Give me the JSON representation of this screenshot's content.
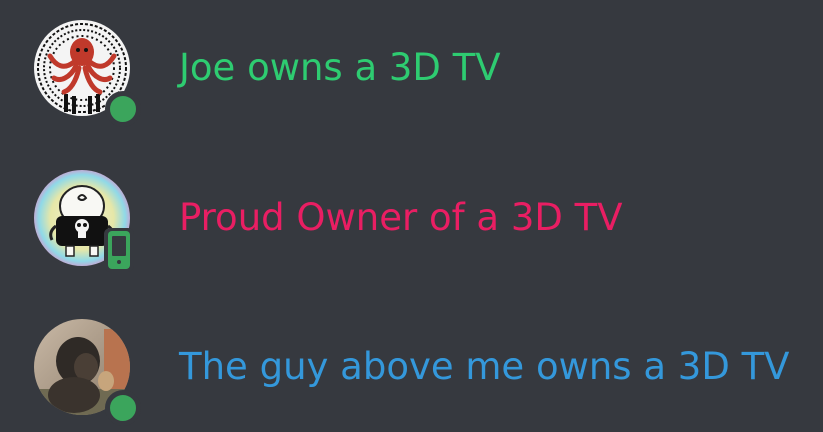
{
  "members": [
    {
      "name": "Joe owns a 3D TV",
      "name_color": "#2ecc71",
      "avatar": "octopus-avatar",
      "status": "online",
      "status_icon": "online-dot-icon"
    },
    {
      "name": "Proud Owner of a 3D TV",
      "name_color": "#e91e63",
      "avatar": "punisher-cartoon-avatar",
      "status": "mobile",
      "status_icon": "mobile-phone-icon"
    },
    {
      "name": "The guy above me owns a 3D TV",
      "name_color": "#3498db",
      "avatar": "photo-avatar",
      "status": "online",
      "status_icon": "online-dot-icon"
    }
  ],
  "colors": {
    "background": "#36393f",
    "status_online": "#3ba55c"
  }
}
